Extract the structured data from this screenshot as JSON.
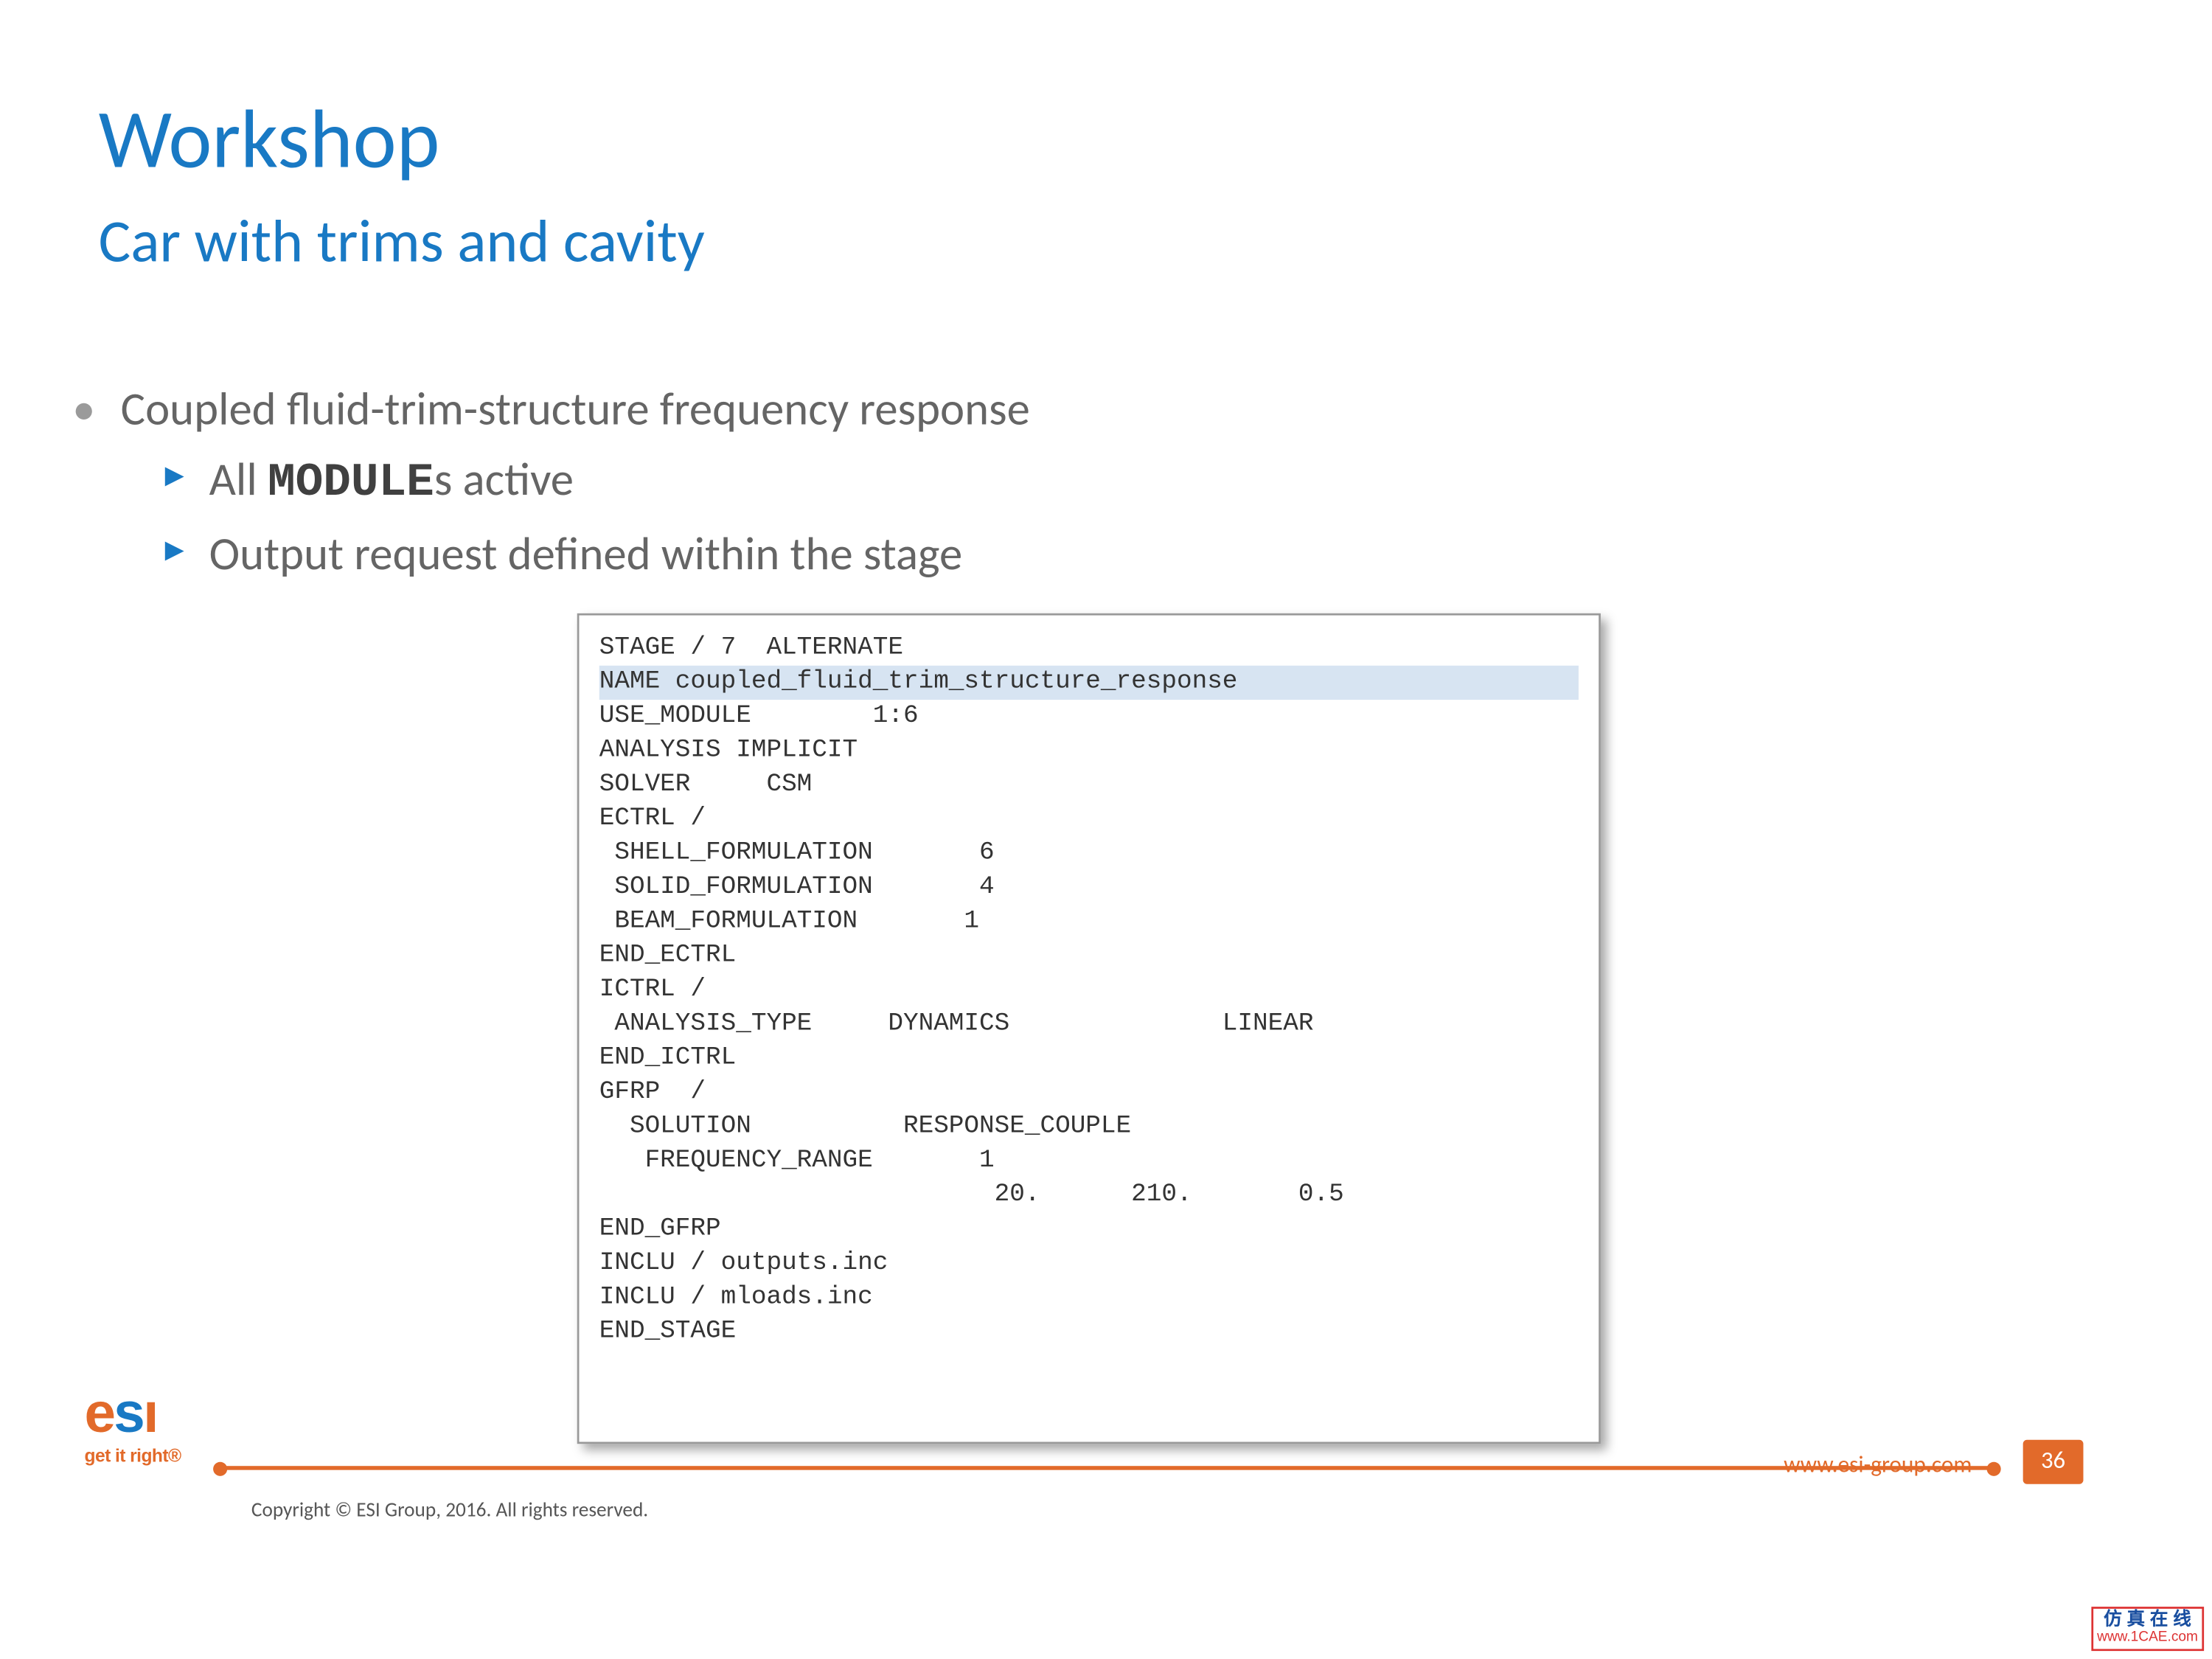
{
  "title": "Workshop",
  "subtitle": "Car with trims and cavity",
  "bullet1": "Coupled fluid-trim-structure frequency response",
  "bullet2_pre": "All ",
  "bullet2_code": "MODULE",
  "bullet2_post": "s active",
  "bullet3": "Output request defined within the stage",
  "code": {
    "l01": "STAGE / 7  ALTERNATE",
    "l02": "NAME coupled_fluid_trim_structure_response",
    "l03": "USE_MODULE        1:6",
    "l04": "ANALYSIS IMPLICIT",
    "l05": "SOLVER     CSM",
    "l06": "ECTRL /",
    "l07": " SHELL_FORMULATION       6",
    "l08": " SOLID_FORMULATION       4",
    "l09": " BEAM_FORMULATION       1",
    "l10": "END_ECTRL",
    "l11": "ICTRL /",
    "l12": " ANALYSIS_TYPE     DYNAMICS              LINEAR",
    "l13": "END_ICTRL",
    "l14": "GFRP  /",
    "l15": "  SOLUTION          RESPONSE_COUPLE",
    "l16": "   FREQUENCY_RANGE       1",
    "l17": "                          20.      210.       0.5",
    "l18": "END_GFRP",
    "l19": "INCLU / outputs.inc",
    "l20": "INCLU / mloads.inc",
    "l21": "END_STAGE"
  },
  "copyright": "Copyright © ESI Group, 2016. All rights reserved.",
  "url": "www.esi-group.com",
  "page": "36",
  "logo_text": "esi",
  "logo_tag": "get it right®",
  "wm_cn": "仿 真 在 线",
  "wm_url": "www.1CAE.com"
}
